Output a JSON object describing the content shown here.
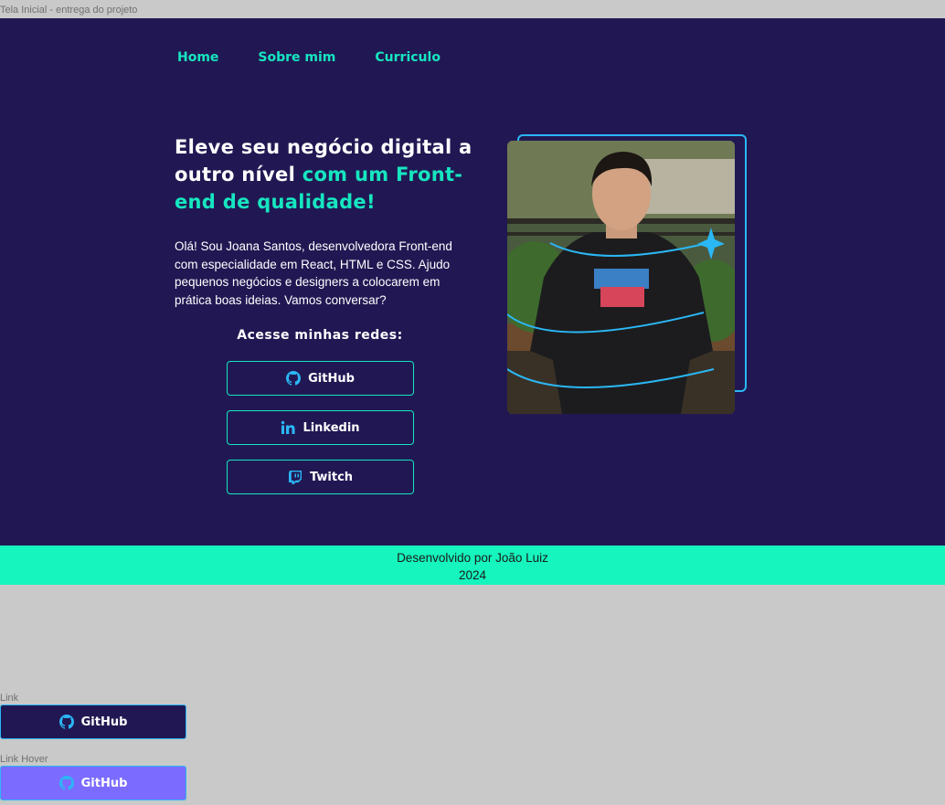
{
  "frame_title": "Tela Inicial - entrega do projeto",
  "nav": {
    "home": "Home",
    "about": "Sobre mim",
    "resume": "Curriculo"
  },
  "hero": {
    "headline_white": "Eleve seu negócio digital a outro nível ",
    "headline_accent": "com um Front-end de qualidade!",
    "intro": "Olá! Sou Joana Santos, desenvolvedora Front-end com especialidade em React, HTML e CSS. Ajudo pequenos negócios e designers a colocarem em prática boas ideias. Vamos conversar?",
    "social_title": "Acesse minhas redes:"
  },
  "social": {
    "github": "GitHub",
    "linkedin": "Linkedin",
    "twitch": "Twitch"
  },
  "footer": {
    "line1": "Desenvolvido por João Luiz",
    "line2": "2024"
  },
  "states": {
    "link_label": "Link",
    "hover_label": "Link Hover",
    "button_text": "GitHub"
  },
  "colors": {
    "background": "#211853",
    "accent": "#16e6c0",
    "icon": "#2ab7f4",
    "footer": "#16f5bd",
    "hover": "#7b6cff"
  }
}
